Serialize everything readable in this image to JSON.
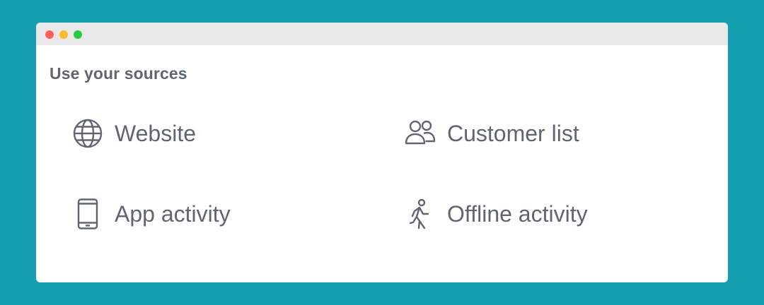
{
  "window": {
    "controls": [
      "close",
      "minimize",
      "zoom"
    ]
  },
  "heading": "Use your sources",
  "sources": [
    {
      "label": "Website",
      "icon": "globe-icon"
    },
    {
      "label": "Customer list",
      "icon": "people-icon"
    },
    {
      "label": "App activity",
      "icon": "mobile-device-icon"
    },
    {
      "label": "Offline activity",
      "icon": "walking-person-icon"
    }
  ],
  "colors": {
    "background": "#139fb0",
    "titlebar": "#e8e8e8",
    "text": "#5f6670",
    "close": "#fe5f57",
    "minimize": "#febc2e",
    "zoom": "#28c840"
  }
}
